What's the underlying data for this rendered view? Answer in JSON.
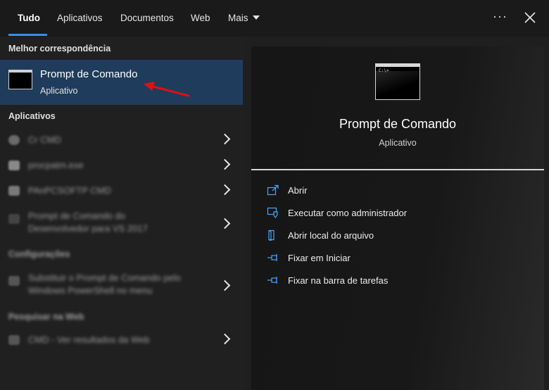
{
  "tabs": [
    "Tudo",
    "Aplicativos",
    "Documentos",
    "Web",
    "Mais"
  ],
  "more_icon": "ellipsis-icon",
  "close_icon": "close-icon",
  "best_match": {
    "section_title": "Melhor correspondência",
    "title": "Prompt de Comando",
    "subtitle": "Aplicativo"
  },
  "apps": {
    "section_title": "Aplicativos",
    "items": [
      "Cr CMD",
      "procpatm.exe",
      "PAnPCSOFTP CMD",
      "Prompt de Comando do Desenvolvedor para VS 2017"
    ]
  },
  "settings": {
    "section_title": "Configurações",
    "items": [
      "Substituir o Prompt de Comando pelo Windows PowerShell no menu"
    ]
  },
  "web": {
    "section_title": "Pesquisar na Web",
    "items": [
      "CMD - Ver resultados da Web"
    ]
  },
  "preview": {
    "title": "Prompt de Comando",
    "subtitle": "Aplicativo"
  },
  "actions": [
    "Abrir",
    "Executar como administrador",
    "Abrir local do arquivo",
    "Fixar em Iniciar",
    "Fixar na barra de tarefas"
  ],
  "colors": {
    "accent": "#3a8ee6",
    "selected": "#1f3c5c",
    "arrow": "#e01010"
  }
}
